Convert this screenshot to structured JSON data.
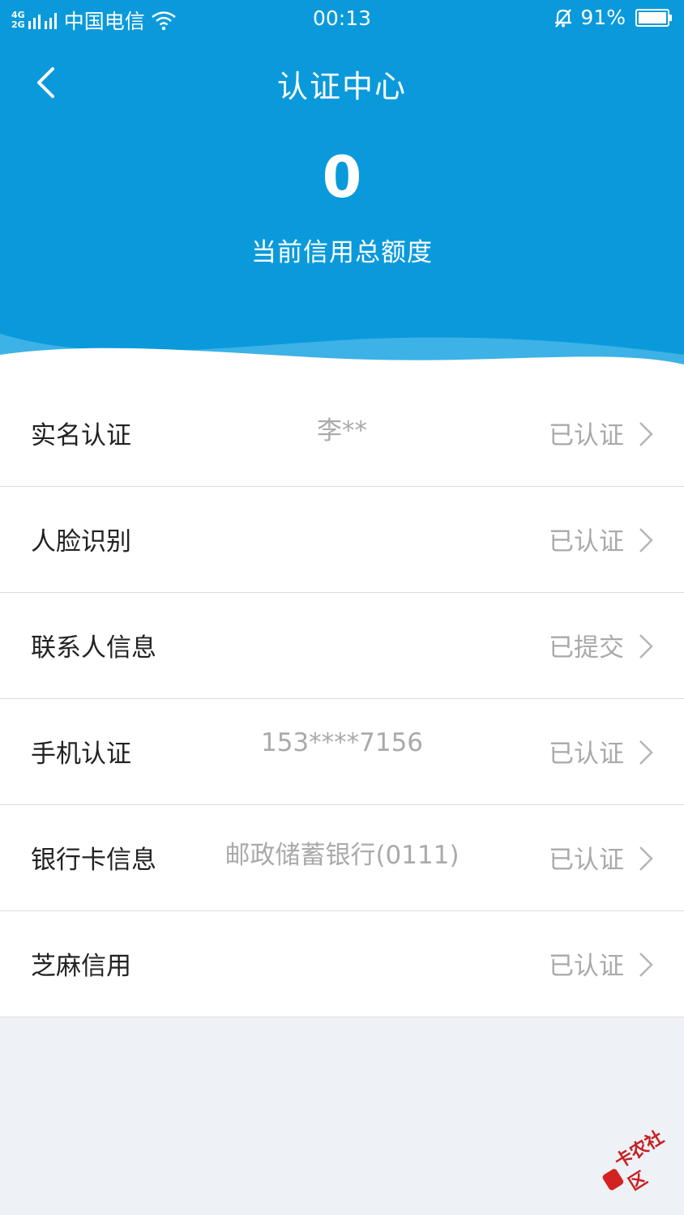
{
  "status_bar": {
    "network_top": "4G",
    "network_bottom": "2G",
    "carrier": "中国电信",
    "time": "00:13",
    "battery": "91%"
  },
  "header": {
    "title": "认证中心",
    "credit_amount": "0",
    "credit_label": "当前信用总额度"
  },
  "colors": {
    "primary": "#0a9adb",
    "wave_light": "#3db2e6",
    "status_text": "#a9a9a9",
    "page_bg": "#eef1f6"
  },
  "items": [
    {
      "label": "实名认证",
      "value": "李**",
      "status": "已认证"
    },
    {
      "label": "人脸识别",
      "value": "",
      "status": "已认证"
    },
    {
      "label": "联系人信息",
      "value": "",
      "status": "已提交"
    },
    {
      "label": "手机认证",
      "value": "153****7156",
      "status": "已认证"
    },
    {
      "label": "银行卡信息",
      "value": "邮政储蓄银行(0111)",
      "status": "已认证"
    },
    {
      "label": "芝麻信用",
      "value": "",
      "status": "已认证"
    }
  ],
  "watermark": {
    "text": "卡农社区"
  }
}
